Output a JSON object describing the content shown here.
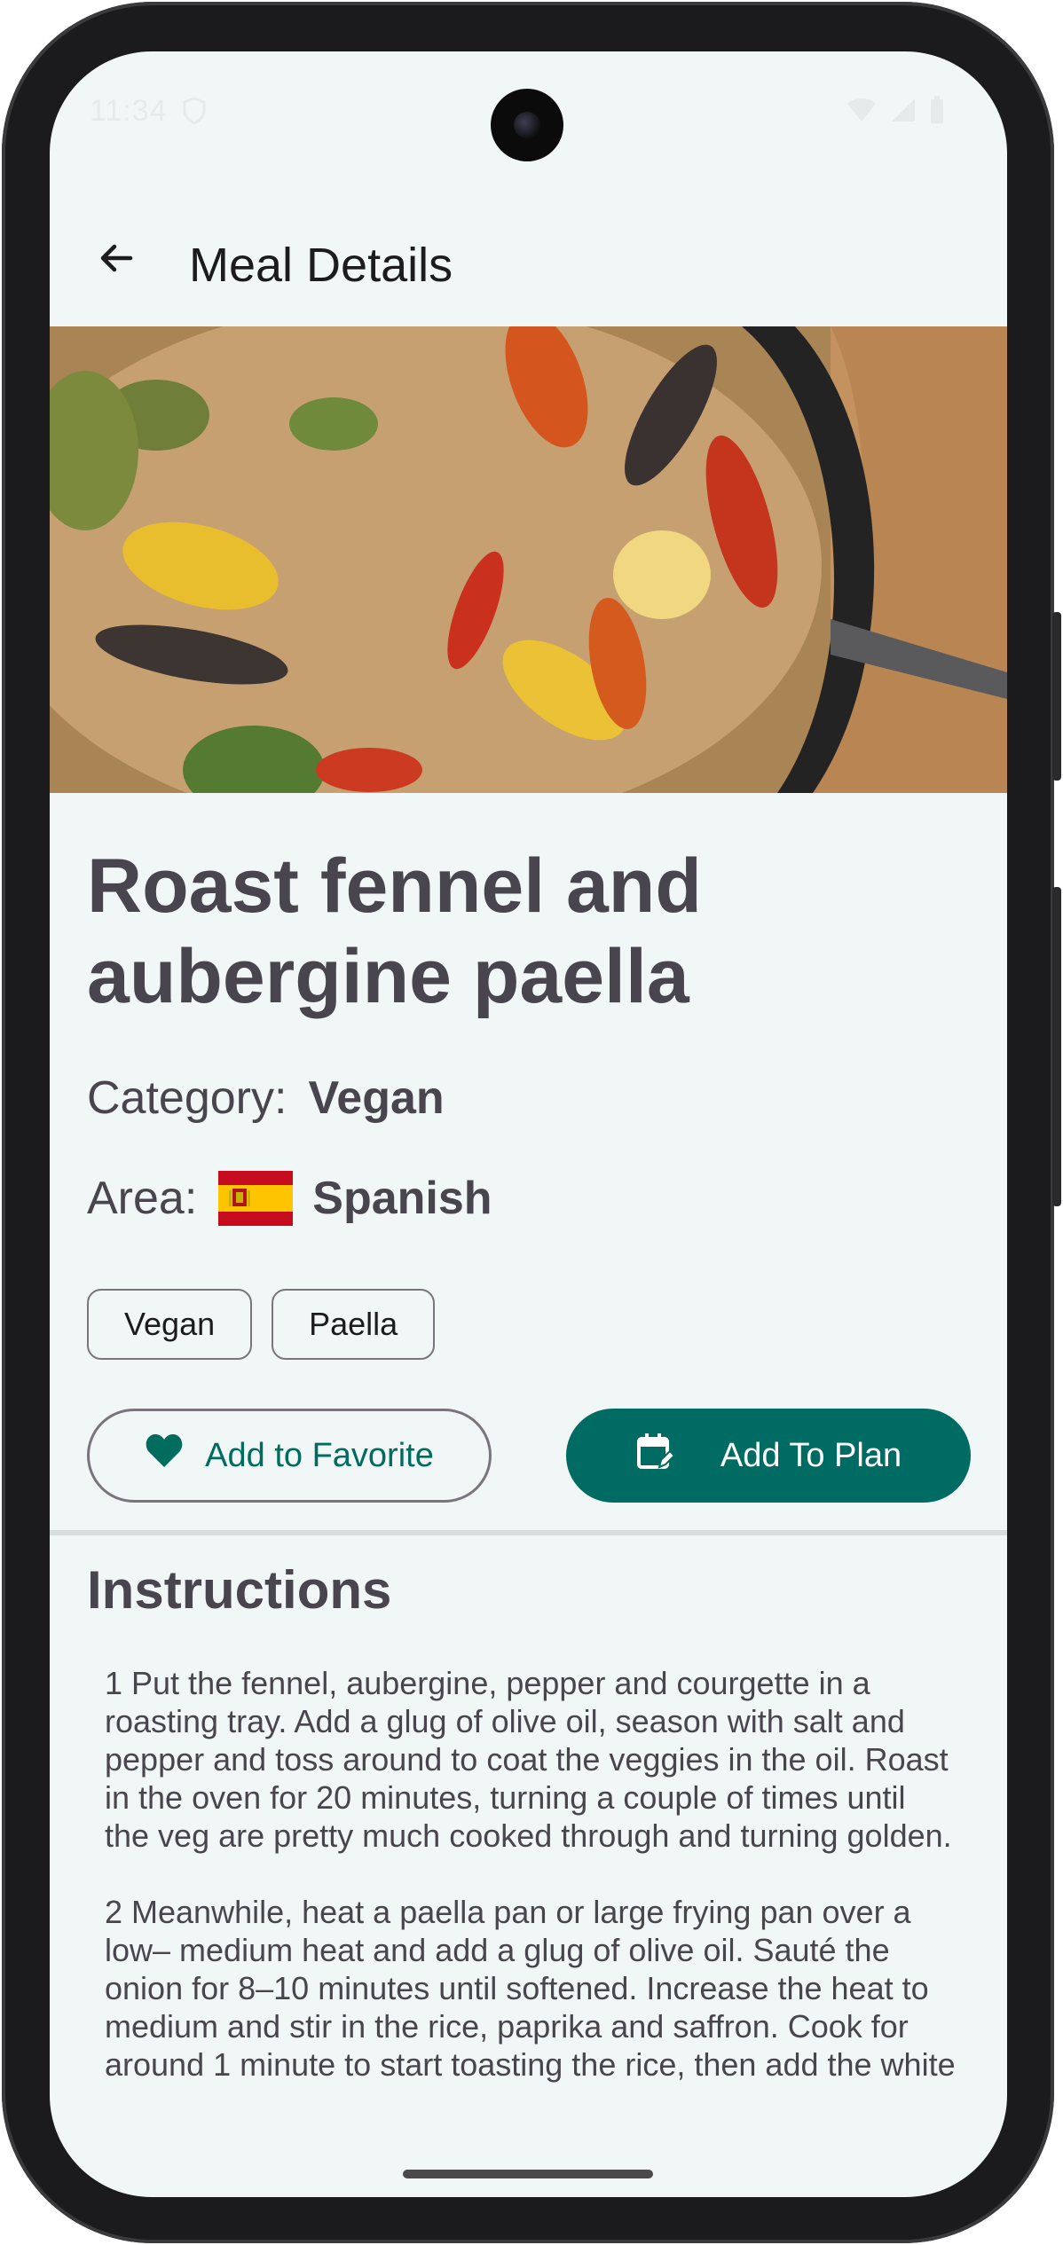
{
  "status_bar": {
    "time": "11:34"
  },
  "app_bar": {
    "title": "Meal Details",
    "back_icon": "arrow-back-icon"
  },
  "meal": {
    "image_description_icon": "meal-photo",
    "title": "Roast fennel and aubergine paella",
    "category_label": "Category:",
    "category": "Vegan",
    "area_label": "Area:",
    "area": "Spanish",
    "area_flag_icon": "spain-flag-icon",
    "tags": [
      "Vegan",
      "Paella"
    ]
  },
  "actions": {
    "favorite_label": "Add to Favorite",
    "favorite_icon": "heart-icon",
    "plan_label": "Add To Plan",
    "plan_icon": "calendar-edit-icon"
  },
  "instructions": {
    "heading": "Instructions",
    "text": "1 Put the fennel, aubergine, pepper and courgette in a roasting tray. Add a glug of olive oil, season with salt and pepper and toss around to coat the veggies in the oil. Roast in the oven for 20 minutes, turning a couple of times until the veg are pretty much cooked through and turning golden.\n\n2 Meanwhile, heat a paella pan or large frying pan over a low– medium heat and add a glug of olive oil. Sauté the onion for 8–10 minutes until softened. Increase the heat to medium and stir in the rice, paprika and saffron. Cook for around 1 minute to start toasting the rice, then add the white wine. Reduce by about half before stirring in"
  },
  "colors": {
    "background": "#f1f7f6",
    "primary": "#006b62",
    "text": "#49454f",
    "outline": "#79747e"
  }
}
